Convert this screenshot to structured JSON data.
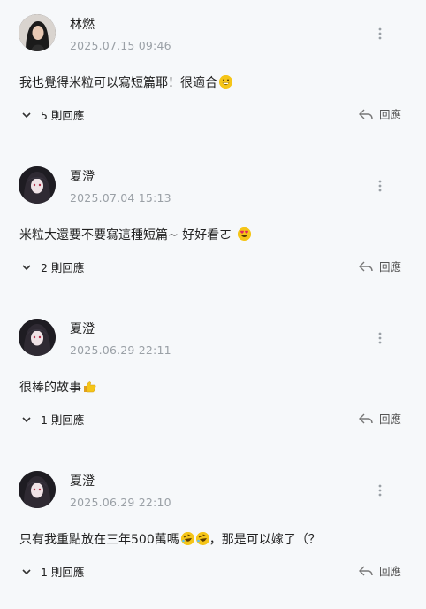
{
  "comments": [
    {
      "name": "林燃",
      "time": "2025.07.15 09:46",
      "text": "我也覺得米粒可以寫短篇耶！很適合",
      "emoji_after": [
        "grinning-face-emoji"
      ],
      "replies": "5 則回應",
      "reply": "回應",
      "avatar_style": "dark-hair-woman"
    },
    {
      "name": "夏澄",
      "time": "2025.07.04 15:13",
      "text": "米粒大還要不要寫這種短篇~ 好好看ㄛ",
      "emoji_after": [
        "heart-eyes-emoji"
      ],
      "replies": "2 則回應",
      "reply": "回應",
      "avatar_style": "anime-girl"
    },
    {
      "name": "夏澄",
      "time": "2025.06.29 22:11",
      "text": "很棒的故事",
      "emoji_after": [
        "thumbs-up-emoji"
      ],
      "replies": "1 則回應",
      "reply": "回應",
      "avatar_style": "anime-girl"
    },
    {
      "name": "夏澄",
      "time": "2025.06.29 22:10",
      "text_before": "只有我重點放在三年500萬嗎",
      "text_after": "，那是可以嫁了（？",
      "emoji_after": [
        "rolling-laughing-emoji",
        "rolling-laughing-emoji"
      ],
      "replies": "1 則回應",
      "reply": "回應",
      "avatar_style": "anime-girl"
    }
  ],
  "colors": {
    "background": "#f6f8fa",
    "text": "#222222",
    "muted": "#9aa0a6",
    "emoji": "#f5c518"
  }
}
